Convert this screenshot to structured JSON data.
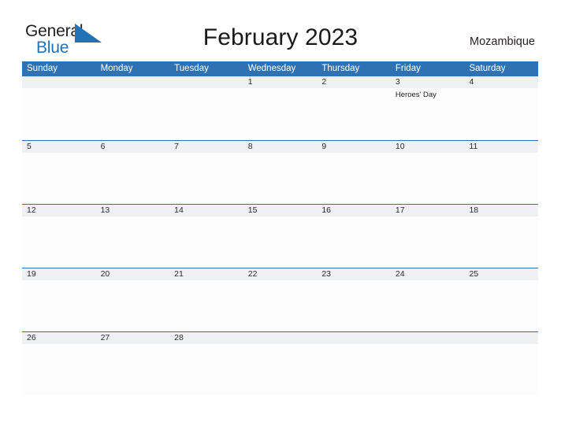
{
  "brand": {
    "name_part1": "General",
    "name_part2": "Blue",
    "flag_icon": "triangle-flag-icon",
    "accent_color": "#2272b8"
  },
  "header": {
    "title": "February 2023",
    "locale": "Mozambique"
  },
  "calendar": {
    "header_bg_color": "#2f72b4",
    "row_band_color": "#eff0f1",
    "weekdays": [
      "Sunday",
      "Monday",
      "Tuesday",
      "Wednesday",
      "Thursday",
      "Friday",
      "Saturday"
    ],
    "weeks": [
      [
        {
          "day": "",
          "events": []
        },
        {
          "day": "",
          "events": []
        },
        {
          "day": "",
          "events": []
        },
        {
          "day": "1",
          "events": []
        },
        {
          "day": "2",
          "events": []
        },
        {
          "day": "3",
          "events": [
            "Heroes' Day"
          ]
        },
        {
          "day": "4",
          "events": []
        }
      ],
      [
        {
          "day": "5",
          "events": []
        },
        {
          "day": "6",
          "events": []
        },
        {
          "day": "7",
          "events": []
        },
        {
          "day": "8",
          "events": []
        },
        {
          "day": "9",
          "events": []
        },
        {
          "day": "10",
          "events": []
        },
        {
          "day": "11",
          "events": []
        }
      ],
      [
        {
          "day": "12",
          "events": []
        },
        {
          "day": "13",
          "events": []
        },
        {
          "day": "14",
          "events": []
        },
        {
          "day": "15",
          "events": []
        },
        {
          "day": "16",
          "events": []
        },
        {
          "day": "17",
          "events": []
        },
        {
          "day": "18",
          "events": []
        }
      ],
      [
        {
          "day": "19",
          "events": []
        },
        {
          "day": "20",
          "events": []
        },
        {
          "day": "21",
          "events": []
        },
        {
          "day": "22",
          "events": []
        },
        {
          "day": "23",
          "events": []
        },
        {
          "day": "24",
          "events": []
        },
        {
          "day": "25",
          "events": []
        }
      ],
      [
        {
          "day": "26",
          "events": []
        },
        {
          "day": "27",
          "events": []
        },
        {
          "day": "28",
          "events": []
        },
        {
          "day": "",
          "events": []
        },
        {
          "day": "",
          "events": []
        },
        {
          "day": "",
          "events": []
        },
        {
          "day": "",
          "events": []
        }
      ]
    ]
  }
}
